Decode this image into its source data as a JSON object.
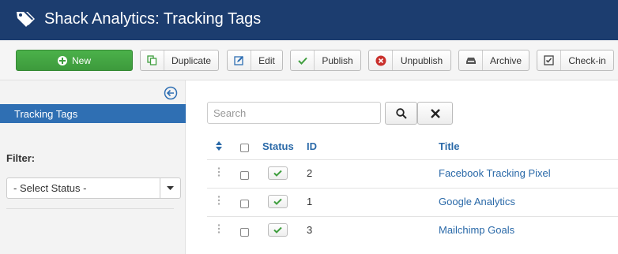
{
  "header": {
    "title": "Shack Analytics: Tracking Tags",
    "icon": "tag-icon"
  },
  "toolbar": {
    "new_label": "New",
    "duplicate_label": "Duplicate",
    "edit_label": "Edit",
    "publish_label": "Publish",
    "unpublish_label": "Unpublish",
    "archive_label": "Archive",
    "checkin_label": "Check-in"
  },
  "sidebar": {
    "active_item": "Tracking Tags",
    "filter_label": "Filter:",
    "status_select": "- Select Status -"
  },
  "search": {
    "placeholder": "Search"
  },
  "table": {
    "headers": {
      "status": "Status",
      "id": "ID",
      "title": "Title"
    },
    "rows": [
      {
        "id": "2",
        "title": "Facebook Tracking Pixel"
      },
      {
        "id": "1",
        "title": "Google Analytics"
      },
      {
        "id": "3",
        "title": "Mailchimp Goals"
      }
    ]
  },
  "colors": {
    "header_bg": "#1c3d6f",
    "accent": "#2f6fb3",
    "new_button": "#3f9e3e",
    "link": "#2a69a8"
  }
}
